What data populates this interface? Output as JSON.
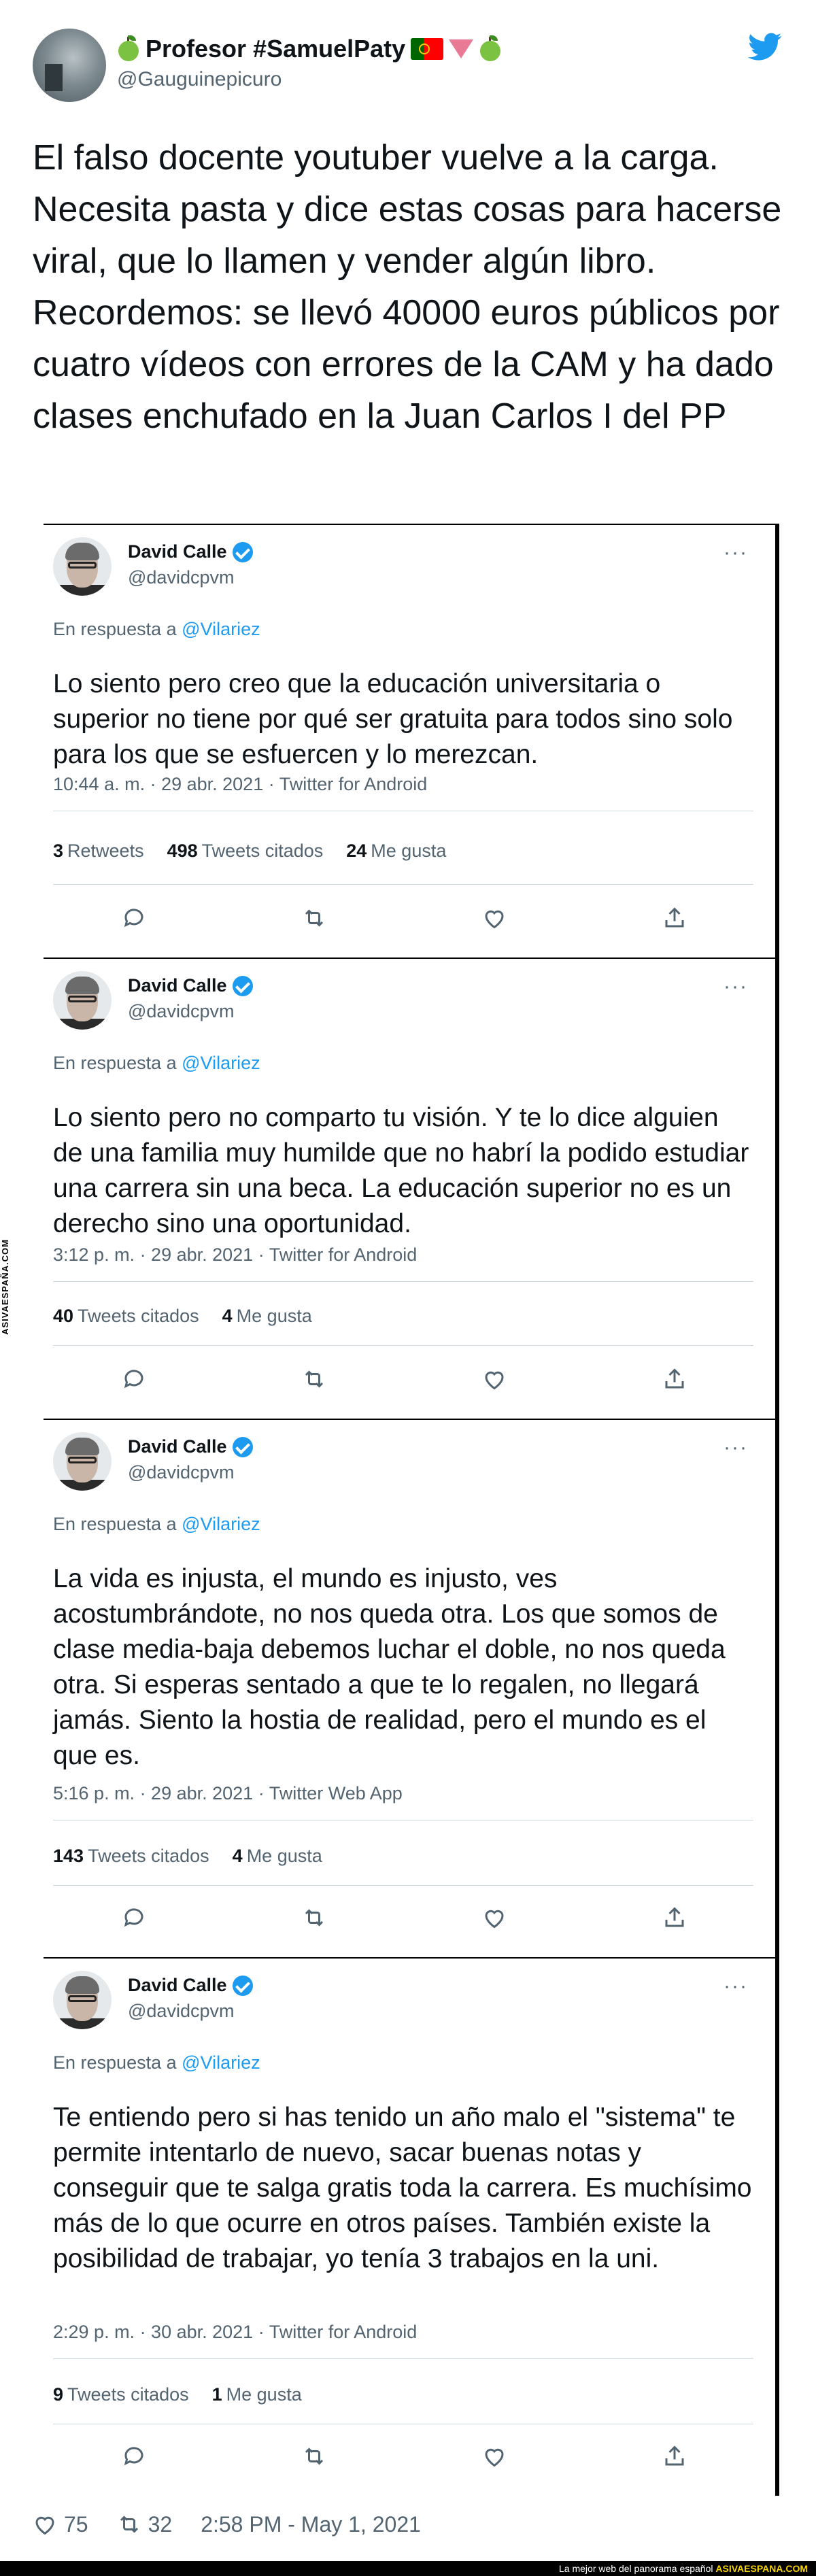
{
  "tweet": {
    "display_name": "Profesor #SamuelPaty",
    "handle": "@Gauguinepicuro",
    "text": "El falso docente youtuber vuelve a la carga. Necesita pasta y dice estas cosas para hacerse viral, que lo llamen y vender algún libro. Recordemos: se llevó 40000 euros públicos por cuatro vídeos con errores de la CAM y ha dado clases enchufado en la Juan Carlos I del PP",
    "likes": "75",
    "retweets": "32",
    "timestamp": "2:58 PM - May 1, 2021"
  },
  "embedded": [
    {
      "name": "David Calle",
      "handle": "@davidcpvm",
      "reply_prefix": "En respuesta a",
      "reply_to": "@Vilariez",
      "text": "Lo siento pero creo que la educación universitaria o superior no tiene por qué ser gratuita para todos sino solo para los que se esfuercen y lo merezcan.",
      "meta": "10:44 a. m. · 29 abr. 2021 · Twitter for Android",
      "stats": [
        {
          "value": "3",
          "label": "Retweets"
        },
        {
          "value": "498",
          "label": "Tweets citados"
        },
        {
          "value": "24",
          "label": "Me gusta"
        }
      ]
    },
    {
      "name": "David Calle",
      "handle": "@davidcpvm",
      "reply_prefix": "En respuesta a",
      "reply_to": "@Vilariez",
      "text": "Lo siento pero no comparto tu visión. Y te lo dice alguien de una familia muy humilde que no habrí la podido estudiar una carrera sin una beca. La educación superior no es un derecho sino una oportunidad.",
      "meta": "3:12 p. m. · 29 abr. 2021 · Twitter for Android",
      "stats": [
        {
          "value": "40",
          "label": "Tweets citados"
        },
        {
          "value": "4",
          "label": "Me gusta"
        }
      ]
    },
    {
      "name": "David Calle",
      "handle": "@davidcpvm",
      "reply_prefix": "En respuesta a",
      "reply_to": "@Vilariez",
      "text": "La vida es injusta, el mundo es injusto, ves acostumbrándote, no nos queda otra. Los que somos de clase media-baja debemos luchar el doble, no nos queda otra. Si esperas sentado a que te lo regalen, no llegará jamás. Siento la hostia de realidad, pero el mundo es el que es.",
      "meta": "5:16 p. m. · 29 abr. 2021 · Twitter Web App",
      "stats": [
        {
          "value": "143",
          "label": "Tweets citados"
        },
        {
          "value": "4",
          "label": "Me gusta"
        }
      ]
    },
    {
      "name": "David Calle",
      "handle": "@davidcpvm",
      "reply_prefix": "En respuesta a",
      "reply_to": "@Vilariez",
      "text": "Te entiendo pero si has tenido un año malo el \"sistema\" te permite intentarlo de nuevo, sacar buenas notas y conseguir que te salga gratis toda la carrera. Es muchísimo más de lo que ocurre en otros países. También existe la posibilidad de trabajar, yo tenía 3 trabajos en la uni.",
      "meta": "2:29 p. m. · 30 abr. 2021 · Twitter for Android",
      "stats": [
        {
          "value": "9",
          "label": "Tweets citados"
        },
        {
          "value": "1",
          "label": "Me gusta"
        }
      ]
    }
  ],
  "watermark": {
    "side": "ASIVAESPAÑA.COM",
    "bottom_prefix": "La mejor web del panorama español",
    "bottom_site": "ASIVAESPANA.COM"
  },
  "colors": {
    "accent": "#1d9bf0",
    "text": "#0f1419",
    "muted": "#536471"
  },
  "icons": [
    "apple-icon",
    "portugal-flag-icon",
    "triangle-icon",
    "twitter-bird-icon",
    "verified-icon",
    "more-icon",
    "reply-icon",
    "retweet-icon",
    "like-icon",
    "share-icon",
    "heart-icon"
  ]
}
